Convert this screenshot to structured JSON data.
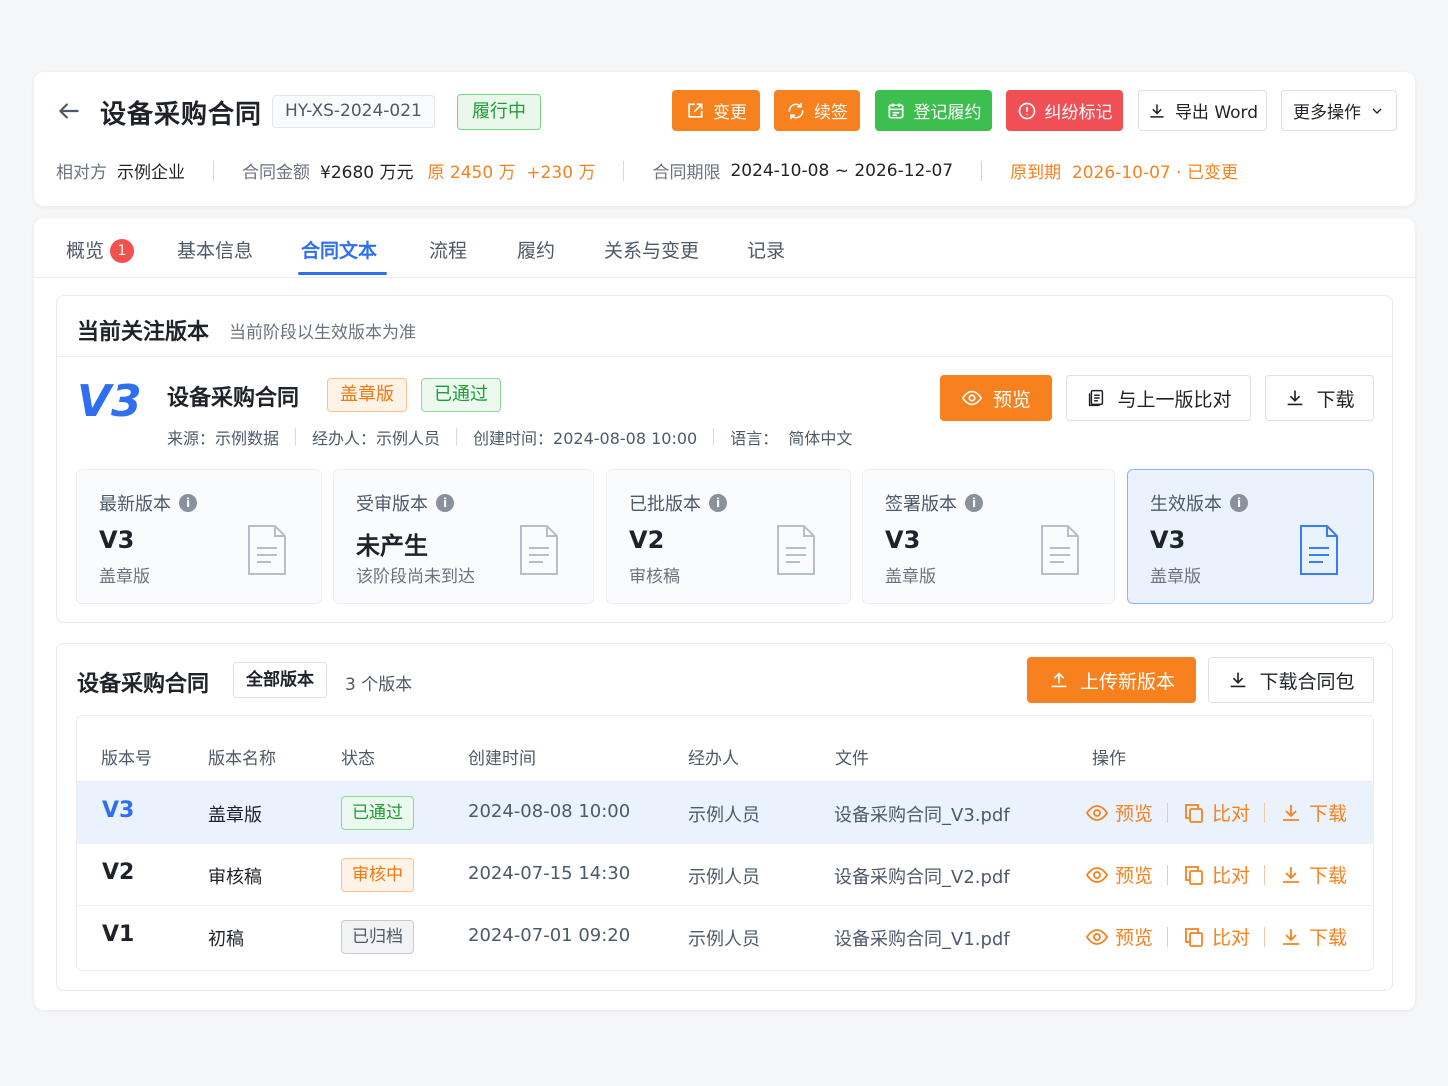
{
  "header": {
    "title": "设备采购合同",
    "code": "HY-XS-2024-021",
    "status": "履行中",
    "buttons": {
      "change": "变更",
      "renew": "续签",
      "record": "登记履约",
      "dispute": "纠纷标记",
      "export": "导出 Word",
      "more": "更多操作"
    },
    "meta": {
      "counterparty_label": "相对方",
      "counterparty": "示例企业",
      "amount_label": "合同金额",
      "amount": "¥2680 万元",
      "amount_change": "原 2450 万  +230 万",
      "period_label": "合同期限",
      "period": "2024-10-08 ~ 2026-12-07",
      "original_due": "原到期  2026-10-07 · 已变更"
    }
  },
  "tabs": [
    {
      "label": "概览",
      "badge": "1"
    },
    {
      "label": "基本信息"
    },
    {
      "label": "合同文本",
      "active": true
    },
    {
      "label": "流程"
    },
    {
      "label": "履约"
    },
    {
      "label": "关系与变更"
    },
    {
      "label": "记录"
    }
  ],
  "focus": {
    "title": "当前关注版本",
    "subtitle": "当前阶段以生效版本为准",
    "version": "V3",
    "doc_title": "设备采购合同",
    "tag_type": "盖章版",
    "tag_status": "已通过",
    "meta": {
      "source": "来源：示例数据",
      "handler": "经办人：示例人员",
      "created": "创建时间：2024-08-08 10:00",
      "language": "语言：  简体中文"
    },
    "buttons": {
      "preview": "预览",
      "compare": "与上一版比对",
      "download": "下载"
    },
    "cards": [
      {
        "label": "最新版本",
        "value": "V3",
        "sub": "盖章版"
      },
      {
        "label": "受审版本",
        "value": "未产生",
        "sub": "该阶段尚未到达"
      },
      {
        "label": "已批版本",
        "value": "V2",
        "sub": "审核稿"
      },
      {
        "label": "签署版本",
        "value": "V3",
        "sub": "盖章版"
      },
      {
        "label": "生效版本",
        "value": "V3",
        "sub": "盖章版",
        "active": true
      }
    ]
  },
  "versions": {
    "title": "设备采购合同",
    "filter": "全部版本",
    "count": "3 个版本",
    "buttons": {
      "upload": "上传新版本",
      "download_pack": "下载合同包"
    },
    "columns": [
      "版本号",
      "版本名称",
      "状态",
      "创建时间",
      "经办人",
      "文件",
      "操作"
    ],
    "rows": [
      {
        "version": "V3",
        "name": "盖章版",
        "status": "已通过",
        "status_kind": "pass",
        "created": "2024-08-08 10:00",
        "handler": "示例人员",
        "file": "设备采购合同_V3.pdf"
      },
      {
        "version": "V2",
        "name": "审核稿",
        "status": "审核中",
        "status_kind": "review",
        "created": "2024-07-15 14:30",
        "handler": "示例人员",
        "file": "设备采购合同_V2.pdf"
      },
      {
        "version": "V1",
        "name": "初稿",
        "status": "已归档",
        "status_kind": "archived",
        "created": "2024-07-01 09:20",
        "handler": "示例人员",
        "file": "设备采购合同_V1.pdf"
      }
    ],
    "row_ops": {
      "preview": "预览",
      "compare": "比对",
      "download": "下载"
    }
  },
  "colors": {
    "accent_blue": "#2e6ff0",
    "accent_orange": "#f7811f",
    "success": "#3cbf4f",
    "danger": "#ef4f55"
  }
}
